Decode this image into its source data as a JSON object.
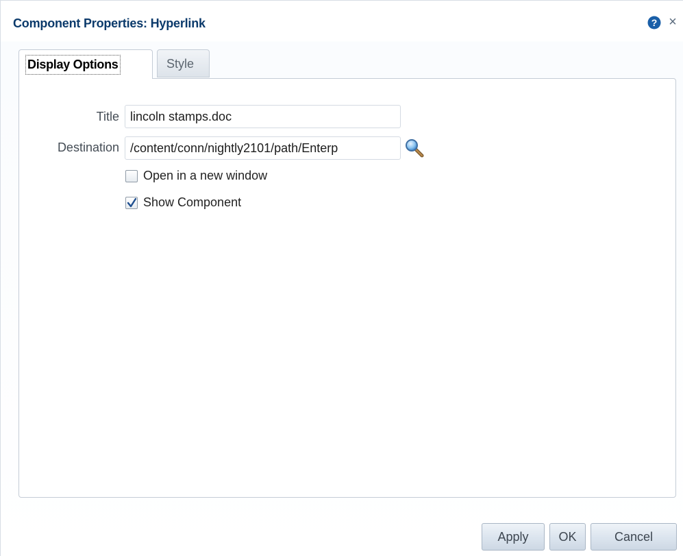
{
  "dialog": {
    "title": "Component Properties: Hyperlink",
    "help_icon": "help-icon",
    "close_label": "×"
  },
  "tabs": [
    {
      "label": "Display Options",
      "active": true
    },
    {
      "label": "Style",
      "active": false
    }
  ],
  "form": {
    "title_label": "Title",
    "title_value": "lincoln stamps.doc",
    "destination_label": "Destination",
    "destination_value": "/content/conn/nightly2101/path/Enterp",
    "destination_icon": "search-icon",
    "open_new_window_label": "Open in a new window",
    "open_new_window_checked": false,
    "show_component_label": "Show Component",
    "show_component_checked": true
  },
  "buttons": {
    "apply": "Apply",
    "ok": "OK",
    "cancel": "Cancel"
  },
  "colors": {
    "title": "#0b3a6b",
    "help_icon": "#1a5fa8",
    "border": "#c4ccd6"
  }
}
